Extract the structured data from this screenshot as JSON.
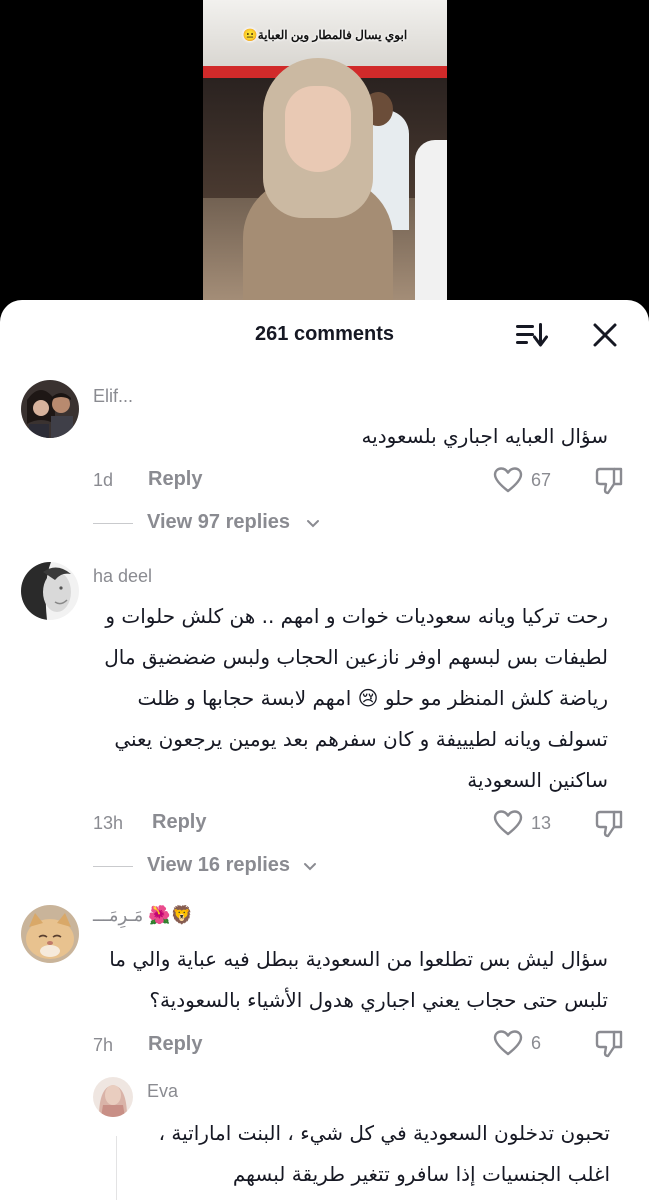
{
  "video": {
    "caption": "ابوي يسال فالمطار وين العباية😐"
  },
  "sheet": {
    "title": "261 comments",
    "sort_icon": "sort-icon",
    "close_icon": "close-icon"
  },
  "comments": [
    {
      "username": "Elif...",
      "text_lines": [
        "سؤال العبايه اجباري بلسعوديه"
      ],
      "time": "1d",
      "reply_label": "Reply",
      "likes": "67",
      "view_replies": "View 97 replies"
    },
    {
      "username": "ha deel",
      "text_lines": [
        "رحت تركيا ويانه سعوديات خوات و امهم .. هن كلش حلوات و",
        "لطيفات بس لبسهم اوفر نازعين الحجاب ولبس ضضضيق مال",
        "رياضة كلش المنظر مو حلو 😢 امهم لابسة حجابها و ظلت",
        "تسولف ويانه لطيييفة و كان سفرهم بعد يومين يرجعون يعني",
        "ساكنين السعودية"
      ],
      "time": "13h",
      "reply_label": "Reply",
      "likes": "13",
      "view_replies": "View 16 replies"
    },
    {
      "username": "🦁🌺 مَـرِمَـــ",
      "text_lines": [
        "سؤال ليش بس تطلعوا من السعودية ببطل فيه عباية والي ما",
        "تلبس حتى حجاب يعني اجباري هدول الأشياء بالسعودية؟"
      ],
      "time": "7h",
      "reply_label": "Reply",
      "likes": "6"
    },
    {
      "username": "Eva",
      "text_lines": [
        "تحبون تدخلون السعودية في كل شيء ، البنت اماراتية ،",
        "اغلب الجنسيات إذا سافرو تتغير طريقة لبسهم"
      ]
    }
  ],
  "colors": {
    "text": "#161823",
    "secondary": "#8a8b91",
    "background": "#ffffff"
  }
}
